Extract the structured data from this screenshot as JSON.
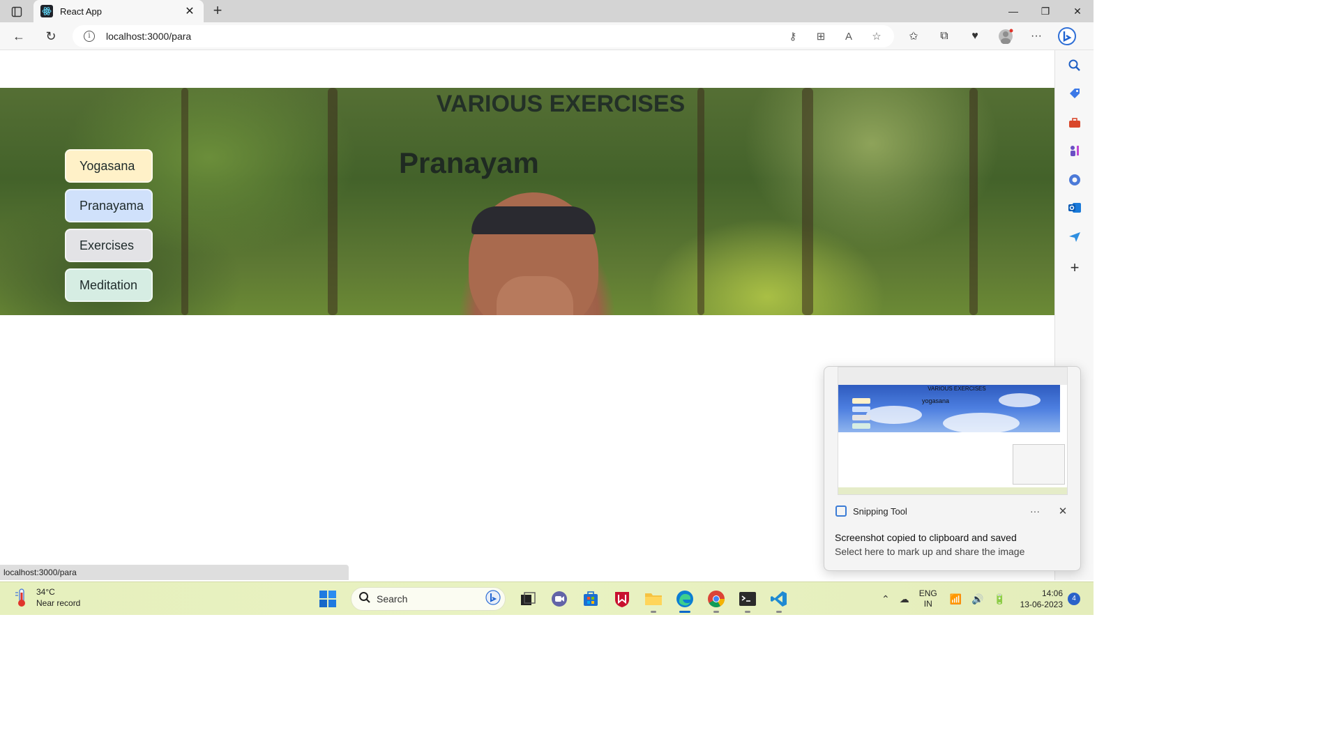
{
  "browser": {
    "tab_title": "React App",
    "url": "localhost:3000/para",
    "status_url": "localhost:3000/para"
  },
  "page": {
    "hero_title": "VARIOUS EXERCISES",
    "hero_subtitle": "Pranayam",
    "menu": [
      {
        "label": "Yogasana",
        "color": "#fff1c8"
      },
      {
        "label": "Pranayama",
        "color": "#d0e1fb"
      },
      {
        "label": "Exercises",
        "color": "#e3e3e6"
      },
      {
        "label": "Meditation",
        "color": "#d6ede3"
      }
    ]
  },
  "notification": {
    "app_name": "Snipping Tool",
    "message": "Screenshot copied to clipboard and saved",
    "sub_message": "Select here to mark up and share the image",
    "thumbnail": {
      "title": "VARIOUS EXERCISES",
      "subtitle": "yogasana"
    }
  },
  "taskbar": {
    "weather_temp": "34°C",
    "weather_desc": "Near record",
    "search_label": "Search",
    "lang_line1": "ENG",
    "lang_line2": "IN",
    "time": "14:06",
    "date": "13-06-2023",
    "notification_count": "4"
  },
  "colors": {
    "accent": "#0a67c9",
    "taskbar_bg": "#e6f0bd"
  }
}
